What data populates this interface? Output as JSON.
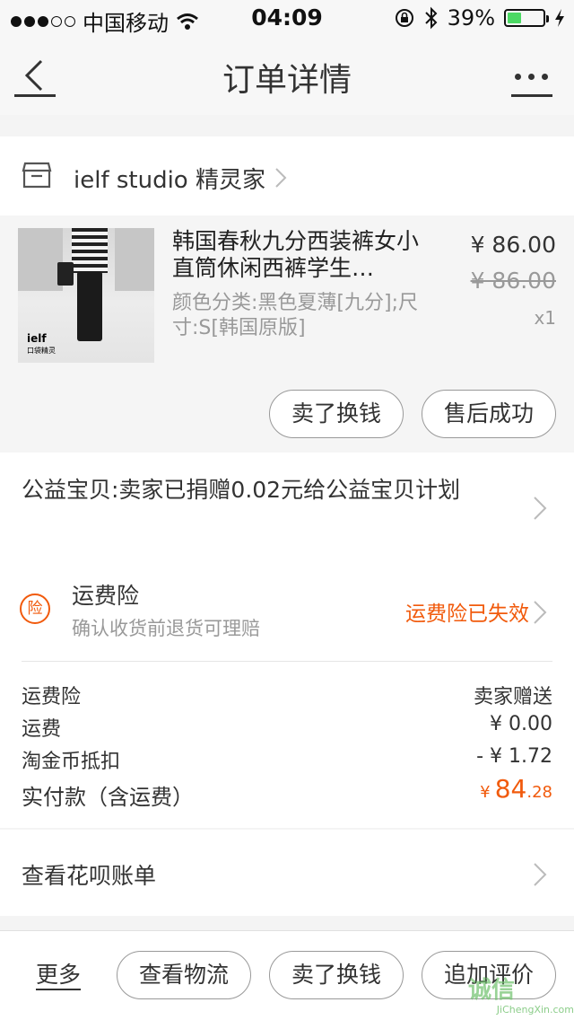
{
  "status_bar": {
    "carrier": "中国移动",
    "time": "04:09",
    "battery": "39%",
    "battery_level": 0.39
  },
  "nav": {
    "title": "订单详情"
  },
  "shop": {
    "name": "ielf studio 精灵家"
  },
  "product": {
    "title": "韩国春秋九分西装裤女小直筒休闲西裤学生…",
    "sku": "颜色分类:黑色夏薄[九分];尺寸:S[韩国原版]",
    "price": "¥ 86.00",
    "original_price": "¥ 86.00",
    "quantity": "x1",
    "image_logo": "ielf",
    "image_logo_sub": "口袋精灵",
    "sell_button": "卖了换钱",
    "aftersale_button": "售后成功"
  },
  "charity": {
    "text": "公益宝贝:卖家已捐赠0.02元给公益宝贝计划"
  },
  "insurance": {
    "badge": "险",
    "name": "运费险",
    "desc": "确认收货前退货可理赔",
    "status": "运费险已失效"
  },
  "fees": {
    "rows": [
      {
        "label": "运费险",
        "value": "卖家赠送"
      },
      {
        "label": "运费",
        "value": "¥ 0.00"
      },
      {
        "label": "淘金币抵扣",
        "value": "- ¥ 1.72"
      }
    ],
    "total_label": "实付款（含运费）",
    "total_currency": "¥",
    "total_int": "84",
    "total_dec": ".28"
  },
  "huabei": {
    "text": "查看花呗账单"
  },
  "bottom_bar": {
    "more": "更多",
    "logistics": "查看物流",
    "sell": "卖了换钱",
    "review": "追加评价"
  },
  "watermark": {
    "text": "诚信",
    "url": "JiChengXin.com"
  },
  "colors": {
    "accent": "#f15a0c",
    "battery": "#4cd964"
  }
}
